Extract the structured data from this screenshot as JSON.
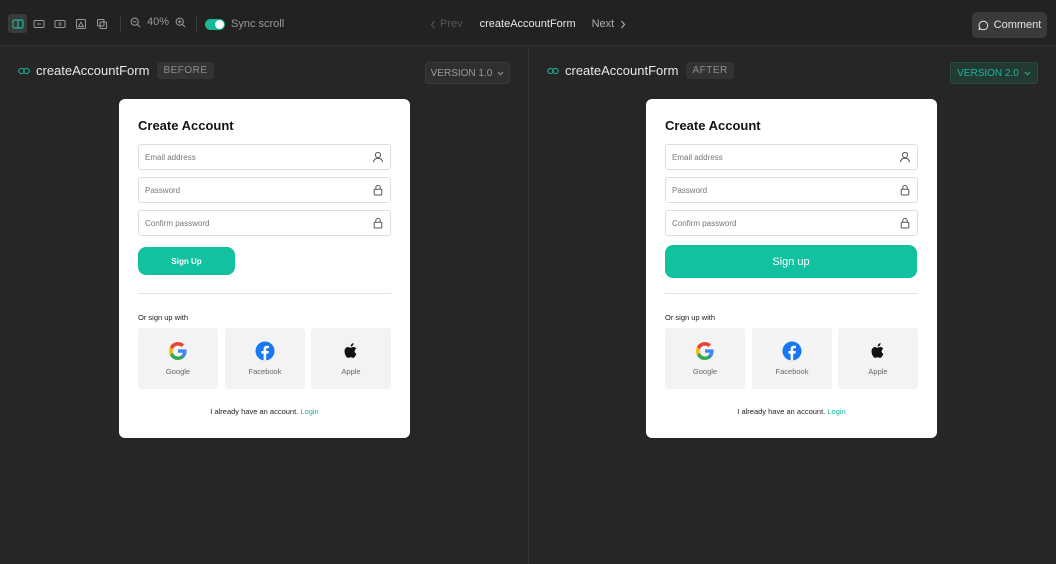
{
  "toolbar": {
    "zoom_level": "40%",
    "sync_label": "Sync scroll",
    "prev_label": "Prev",
    "title": "createAccountForm",
    "next_label": "Next",
    "comment_label": "Comment"
  },
  "left_pane": {
    "title": "createAccountForm",
    "badge": "BEFORE",
    "version": "VERSION 1.0",
    "form": {
      "heading": "Create Account",
      "email_placeholder": "Email address",
      "password_placeholder": "Password",
      "confirm_placeholder": "Confirm password",
      "signup_label": "Sign Up",
      "or_label": "Or sign up with",
      "social": [
        "Google",
        "Facebook",
        "Apple"
      ],
      "footer_text": "I already have an account.",
      "footer_link": "Login"
    }
  },
  "right_pane": {
    "title": "createAccountForm",
    "badge": "AFTER",
    "version": "VERSION 2.0",
    "form": {
      "heading": "Create Account",
      "email_placeholder": "Email address",
      "password_placeholder": "Password",
      "confirm_placeholder": "Confirm password",
      "signup_label": "Sign up",
      "or_label": "Or sign up with",
      "social": [
        "Google",
        "Facebook",
        "Apple"
      ],
      "footer_text": "I already have an account.",
      "footer_link": "Login"
    }
  },
  "colors": {
    "accent": "#12c1a0",
    "background": "#262626",
    "card": "#ffffff"
  },
  "icons": [
    "split-view-icon",
    "side-by-side-icon",
    "slider-icon",
    "overlay-icon",
    "onion-skin-icon",
    "zoom-out-icon",
    "zoom-in-icon",
    "chevron-left-icon",
    "chevron-right-icon",
    "comment-icon",
    "link-icon",
    "chevron-down-icon",
    "user-icon",
    "lock-icon",
    "google-icon",
    "facebook-icon",
    "apple-icon"
  ]
}
